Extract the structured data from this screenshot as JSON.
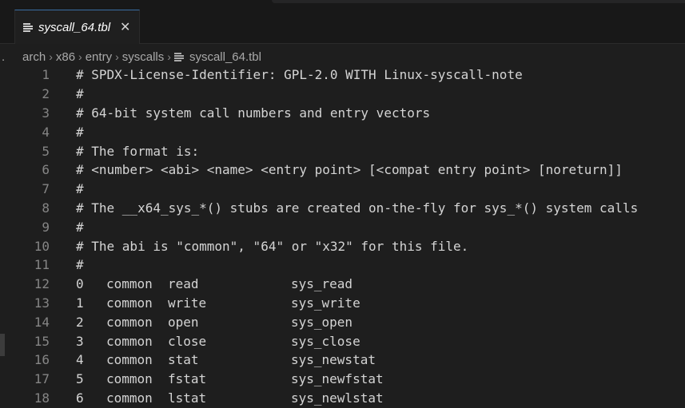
{
  "tab": {
    "label": "syscall_64.tbl",
    "icon": "lines-file-icon",
    "close": "✕"
  },
  "breadcrumb": {
    "lead": ".",
    "items": [
      "arch",
      "x86",
      "entry",
      "syscalls"
    ],
    "file": "syscall_64.tbl",
    "separator": "›"
  },
  "editor": {
    "comment_lines": [
      {
        "num": "1",
        "text": "# SPDX-License-Identifier: GPL-2.0 WITH Linux-syscall-note"
      },
      {
        "num": "2",
        "text": "#"
      },
      {
        "num": "3",
        "text": "# 64-bit system call numbers and entry vectors"
      },
      {
        "num": "4",
        "text": "#"
      },
      {
        "num": "5",
        "text": "# The format is:"
      },
      {
        "num": "6",
        "text": "# <number> <abi> <name> <entry point> [<compat entry point> [noreturn]]"
      },
      {
        "num": "7",
        "text": "#"
      },
      {
        "num": "8",
        "text": "# The __x64_sys_*() stubs are created on-the-fly for sys_*() system calls"
      },
      {
        "num": "9",
        "text": "#"
      },
      {
        "num": "10",
        "text": "# The abi is \"common\", \"64\" or \"x32\" for this file."
      },
      {
        "num": "11",
        "text": "#"
      }
    ],
    "table_rows": [
      {
        "num": "12",
        "number": "0",
        "abi": "common",
        "name": "read",
        "entry": "sys_read"
      },
      {
        "num": "13",
        "number": "1",
        "abi": "common",
        "name": "write",
        "entry": "sys_write"
      },
      {
        "num": "14",
        "number": "2",
        "abi": "common",
        "name": "open",
        "entry": "sys_open"
      },
      {
        "num": "15",
        "number": "3",
        "abi": "common",
        "name": "close",
        "entry": "sys_close"
      },
      {
        "num": "16",
        "number": "4",
        "abi": "common",
        "name": "stat",
        "entry": "sys_newstat"
      },
      {
        "num": "17",
        "number": "5",
        "abi": "common",
        "name": "fstat",
        "entry": "sys_newfstat"
      },
      {
        "num": "18",
        "number": "6",
        "abi": "common",
        "name": "lstat",
        "entry": "sys_newlstat"
      }
    ]
  }
}
